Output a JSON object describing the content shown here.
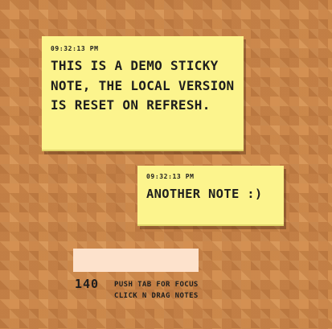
{
  "notes": [
    {
      "timestamp": "09:32:13 PM",
      "text": "THIS IS A DEMO STICKY NOTE, THE LOCAL VERSION IS RESET ON REFRESH."
    },
    {
      "timestamp": "09:32:13 PM",
      "text": "ANOTHER NOTE :)"
    }
  ],
  "composer": {
    "value": "",
    "placeholder": ""
  },
  "footer": {
    "char_count": "140",
    "hint_line_1": "PUSH TAB FOR FOCUS",
    "hint_line_2": "CLICK N DRAG NOTES"
  },
  "colors": {
    "board": "#d08a4c",
    "note": "#fcf48d",
    "composer": "#fde2cc",
    "text": "#1e1e1e"
  }
}
